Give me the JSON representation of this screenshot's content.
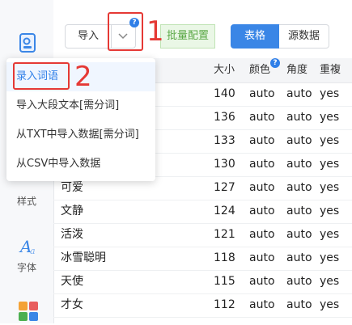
{
  "toolbar": {
    "import_label": "导入",
    "help_badge": "?",
    "batch_config_label": "批量配置",
    "tabs": [
      "表格",
      "源数据"
    ]
  },
  "import_menu": {
    "items": [
      "录入词语",
      "导入大段文本[需分词]",
      "从TXT中导入数据[需分词]",
      "从CSV中导入数据"
    ]
  },
  "annotations": [
    "1",
    "2"
  ],
  "sidebar": {
    "items": [
      {
        "label": "",
        "icon": "words-icon"
      },
      {
        "label": "样式",
        "icon": "style-icon"
      },
      {
        "label": "字体",
        "icon": "font-icon"
      },
      {
        "label": "",
        "icon": "shape-icon"
      }
    ]
  },
  "table": {
    "headers": {
      "size": "大小",
      "color": "颜色",
      "angle": "角度",
      "repeat": "重複"
    },
    "header_help_badge": "?",
    "rows": [
      {
        "word": "",
        "size": "140",
        "color": "auto",
        "angle": "auto",
        "repeat": "yes"
      },
      {
        "word": "",
        "size": "136",
        "color": "auto",
        "angle": "auto",
        "repeat": "yes"
      },
      {
        "word": "",
        "size": "133",
        "color": "auto",
        "angle": "auto",
        "repeat": "yes"
      },
      {
        "word": "",
        "size": "130",
        "color": "auto",
        "angle": "auto",
        "repeat": "yes"
      },
      {
        "word": "可爱",
        "size": "127",
        "color": "auto",
        "angle": "auto",
        "repeat": "yes"
      },
      {
        "word": "文静",
        "size": "124",
        "color": "auto",
        "angle": "auto",
        "repeat": "yes"
      },
      {
        "word": "活泼",
        "size": "121",
        "color": "auto",
        "angle": "auto",
        "repeat": "yes"
      },
      {
        "word": "冰雪聪明",
        "size": "118",
        "color": "auto",
        "angle": "auto",
        "repeat": "yes"
      },
      {
        "word": "天使",
        "size": "115",
        "color": "auto",
        "angle": "auto",
        "repeat": "yes"
      },
      {
        "word": "才女",
        "size": "112",
        "color": "auto",
        "angle": "auto",
        "repeat": "yes"
      }
    ]
  },
  "colors": {
    "accent": "#3a86e6",
    "annotation_red": "#e53935",
    "batch_green": "#5aa845"
  }
}
